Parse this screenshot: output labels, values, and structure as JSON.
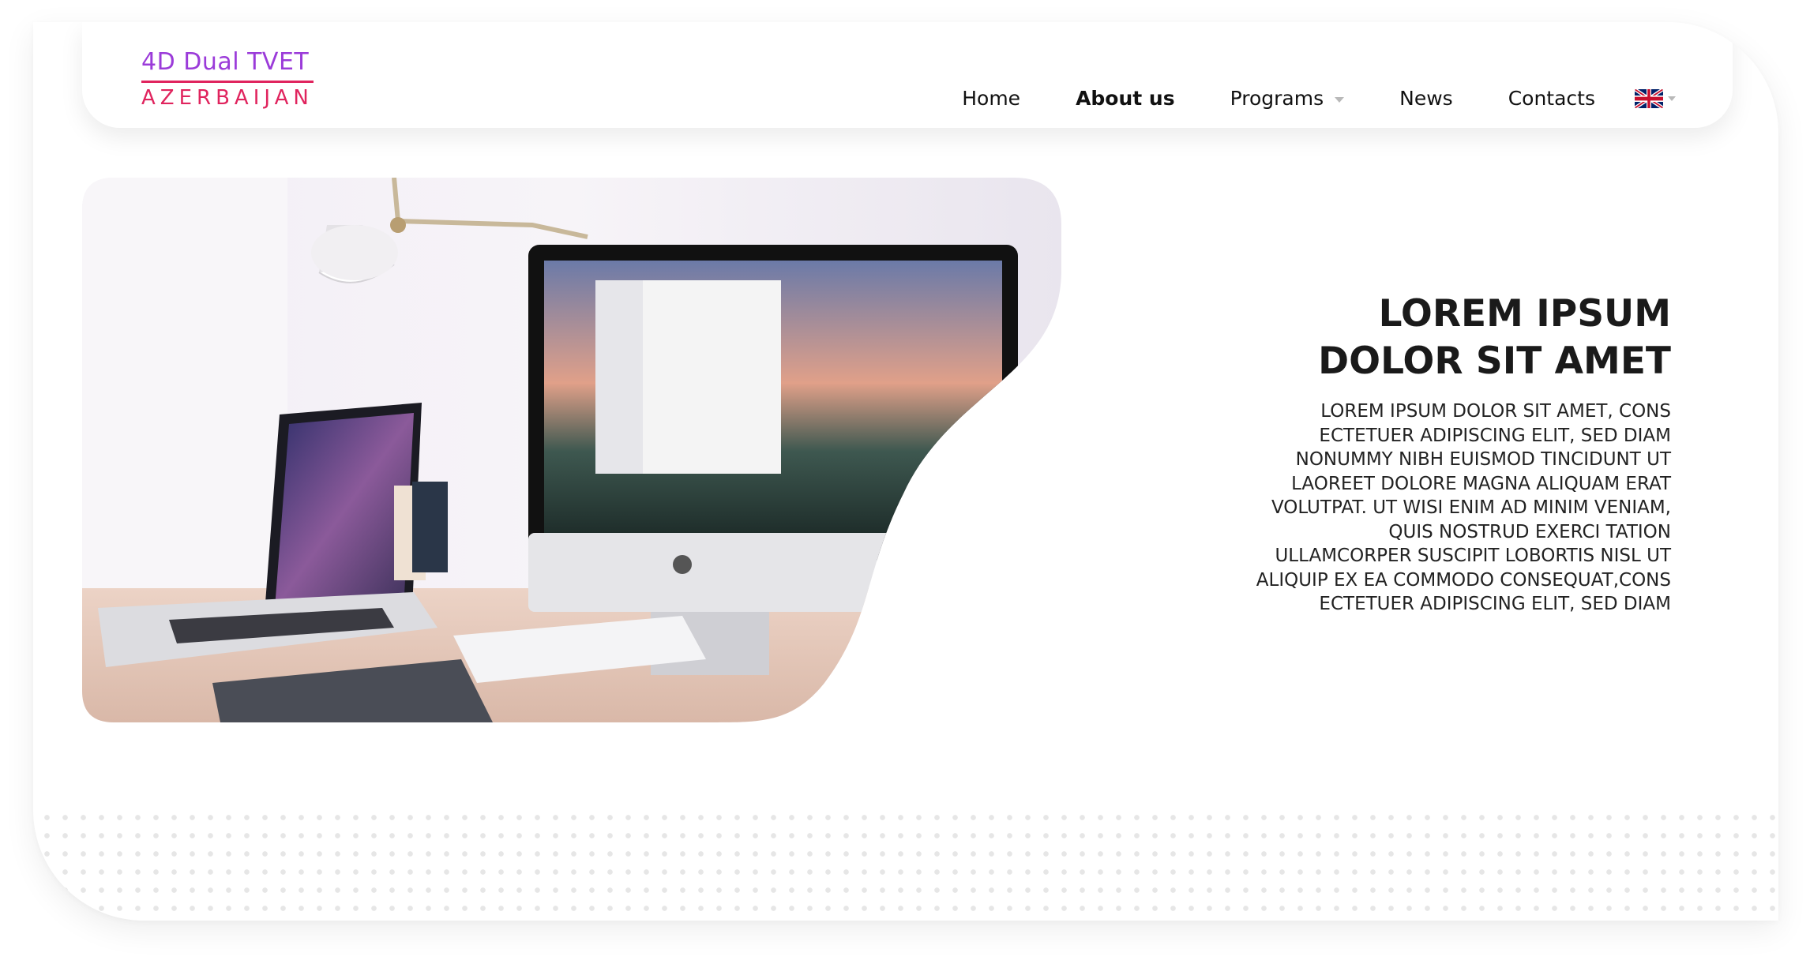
{
  "brand": {
    "line1": "4D Dual TVET",
    "line2": "AZERBAIJAN",
    "colors": {
      "purple": "#9b3bd9",
      "pink": "#e0245e"
    }
  },
  "nav": {
    "home": "Home",
    "about": "About us",
    "programs": "Programs",
    "news": "News",
    "contacts": "Contacts",
    "active": "About us",
    "language_icon": "uk-flag-icon"
  },
  "hero": {
    "image": "workspace-photo",
    "title": "LOREM IPSUM\nDOLOR SIT AMET",
    "body": "LOREM IPSUM DOLOR SIT AMET, CONS\nECTETUER ADIPISCING ELIT, SED DIAM\nNONUMMY NIBH EUISMOD TINCIDUNT UT\nLAOREET DOLORE MAGNA ALIQUAM ERAT\nVOLUTPAT. UT WISI ENIM AD MINIM VENIAM,\nQUIS NOSTRUD EXERCI TATION\nULLAMCORPER SUSCIPIT LOBORTIS NISL UT\nALIQUIP EX EA COMMODO CONSEQUAT,CONS\nECTETUER ADIPISCING ELIT, SED DIAM"
  }
}
